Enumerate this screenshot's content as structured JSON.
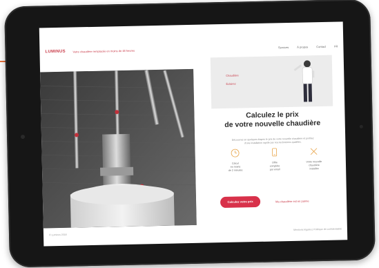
{
  "brand": {
    "logo": "LUMINUS",
    "tagline": "Votre chaudière remplacée en moins de 48 heures"
  },
  "nav": {
    "items": [
      "Services",
      "À propos",
      "Contact",
      "FR"
    ]
  },
  "banner": {
    "line1": "Chaudière",
    "line2": "Éclairez"
  },
  "hero": {
    "title_line1": "Calculez le prix",
    "title_line2": "de votre nouvelle chaudière"
  },
  "subtitle": {
    "line1": "Découvrez en quelques étapes le prix de votre nouvelle chaudière et profitez",
    "line2": "d'une installation rapide par nos techniciens qualifiés."
  },
  "features": [
    {
      "icon": "clock-icon",
      "label_line1": "Calcul",
      "label_line2": "en moins",
      "label_line3": "de 2 minutes"
    },
    {
      "icon": "phone-icon",
      "label_line1": "Offre",
      "label_line2": "complète",
      "label_line3": "par email"
    },
    {
      "icon": "tools-icon",
      "label_line1": "Votre nouvelle",
      "label_line2": "chaudière",
      "label_line3": "installée"
    }
  ],
  "cta": {
    "label": "Calculez votre prix"
  },
  "link": {
    "label": "Ma chaudière est en panne"
  },
  "footer": {
    "left": "© Luminus 2018",
    "right": "Mentions légales | Politique de confidentialité"
  },
  "colors": {
    "accent": "#d8314a",
    "text": "#2a2a2a",
    "device": "#161616"
  }
}
